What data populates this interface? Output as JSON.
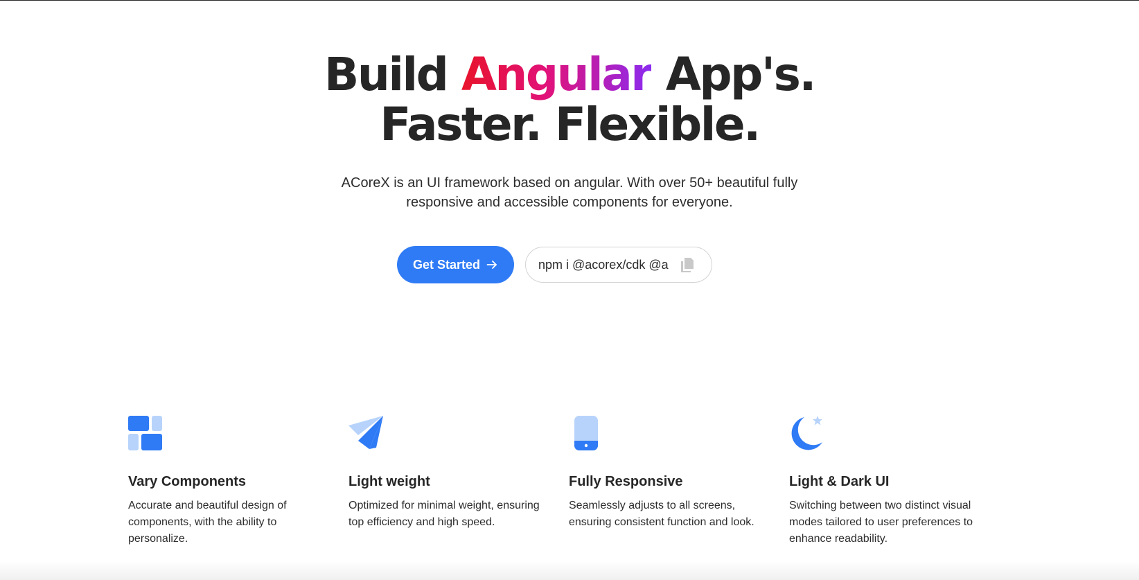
{
  "hero": {
    "headline_prefix": "Build",
    "headline_highlight": "Angular",
    "headline_suffix": "App's.",
    "headline_line2": "Faster. Flexible.",
    "subtitle": "ACoreX is an UI framework based on angular. With over 50+ beautiful fully responsive and accessible components for everyone.",
    "get_started_label": "Get Started",
    "install_command": "npm i @acorex/cdk @acorex/components"
  },
  "features": [
    {
      "icon": "components-grid-icon",
      "title": "Vary Components",
      "description": "Accurate and beautiful design of components, with the ability to personalize."
    },
    {
      "icon": "paper-plane-icon",
      "title": "Light weight",
      "description": "Optimized for minimal weight, ensuring top efficiency and high speed."
    },
    {
      "icon": "mobile-device-icon",
      "title": "Fully Responsive",
      "description": "Seamlessly adjusts to all screens, ensuring consistent function and look."
    },
    {
      "icon": "moon-star-icon",
      "title": "Light & Dark UI",
      "description": "Switching between two distinct visual modes tailored to user preferences to enhance readability."
    }
  ],
  "colors": {
    "accent": "#2f7bf5",
    "icon_light": "#b7d3fb",
    "gradient_start": "#e8132a",
    "gradient_end": "#8b2bf0"
  }
}
